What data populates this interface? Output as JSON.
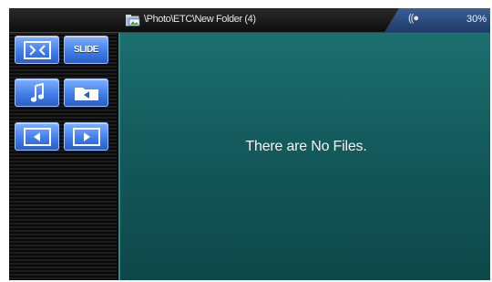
{
  "statusbar": {
    "path": "\\Photo\\ETC\\New Folder (4)",
    "battery": "30%",
    "folder_icon": "folder-picture-icon",
    "signal_icon": "signal-icon",
    "tab_color": "#2b4c80"
  },
  "sidebar": {
    "buttons": [
      {
        "name": "fit-screen-button",
        "icon": "fit-screen-icon"
      },
      {
        "name": "slide-button",
        "label": "SLIDE"
      },
      {
        "name": "music-button",
        "icon": "music-note-icon"
      },
      {
        "name": "folder-back-button",
        "icon": "folder-back-icon"
      },
      {
        "name": "previous-button",
        "icon": "arrow-left-icon"
      },
      {
        "name": "next-button",
        "icon": "arrow-right-icon"
      }
    ],
    "button_color": "#3d7ae6"
  },
  "content": {
    "message": "There are No Files.",
    "background": "#145a5c"
  }
}
